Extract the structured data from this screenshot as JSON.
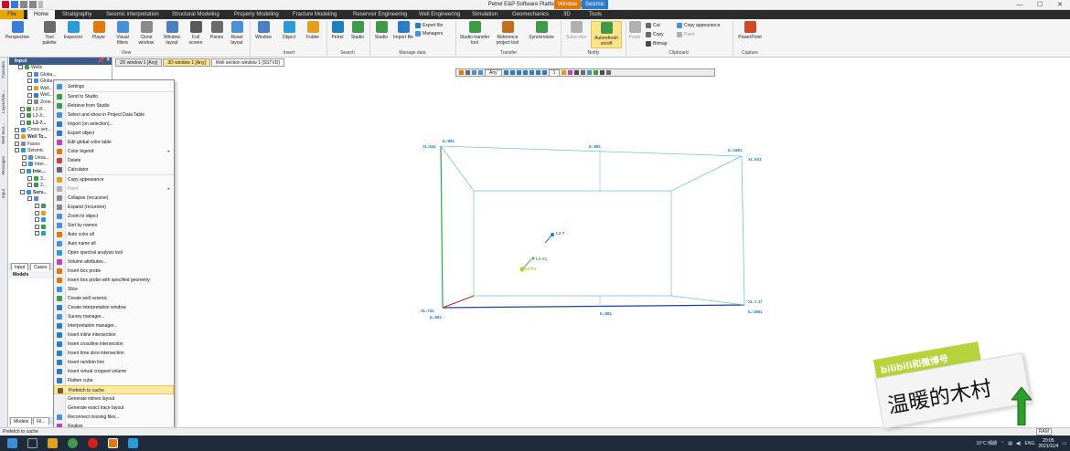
{
  "titlebar": {
    "title": "Petrel E&P Software Platform - [Video]",
    "context_window": "Window",
    "context_seismic": "Seismic",
    "minimize": "—",
    "maximize": "☐",
    "close": "✕"
  },
  "tabs": [
    "File",
    "Home",
    "Stratigraphy",
    "Seismic interpretation",
    "Structural Modeling",
    "Property Modeling",
    "Fracture Modeling",
    "Reservoir Engineering",
    "Well Engineering",
    "Simulation",
    "Geomechanics",
    "3D",
    "Tools"
  ],
  "ribbon": {
    "buttons": [
      {
        "label": "Perspective",
        "color": "#3a7bd5"
      },
      {
        "label": "Tool palette",
        "color": "#6a6a6a"
      },
      {
        "label": "Inspector",
        "color": "#2a9bd8"
      },
      {
        "label": "Player",
        "color": "#e07a10"
      },
      {
        "label": "Visual filters",
        "color": "#4a90d9"
      },
      {
        "label": "Clone window",
        "color": "#8a8a8a"
      },
      {
        "label": "Window layout",
        "color": "#4a7fc1"
      },
      {
        "label": "Full screen",
        "color": "#5a5a5a"
      },
      {
        "label": "Panes",
        "color": "#6b6b6b"
      },
      {
        "label": "Reset layout",
        "color": "#4a90d9"
      },
      {
        "label": "Window",
        "color": "#4a7fc1"
      },
      {
        "label": "Object",
        "color": "#2a9bd8"
      },
      {
        "label": "Folder",
        "color": "#e0a020"
      },
      {
        "label": "Petrel",
        "color": "#1e7fc0"
      },
      {
        "label": "Studio",
        "color": "#3f9a4a"
      },
      {
        "label": "Studio",
        "color": "#3f9a4a"
      },
      {
        "label": "Import file",
        "color": "#2a7bc8"
      },
      {
        "label": "Studio transfer tool",
        "color": "#3f9a4a"
      },
      {
        "label": "Reference project tool",
        "color": "#c07020"
      },
      {
        "label": "Synchronize",
        "color": "#3f9a4a"
      },
      {
        "label": "Subscribe",
        "color": "#b0b0b0"
      },
      {
        "label": "Autorefresh on/off",
        "color": "#3f9a4a"
      },
      {
        "label": "Paste",
        "color": "#b0b0b0"
      },
      {
        "label": "PowerPoint",
        "color": "#d04a2a"
      }
    ],
    "small": {
      "export_file": "Export file",
      "managers": "Managers",
      "cut": "Cut",
      "copy": "Copy",
      "bitmap": "Bitmap",
      "copy_appearance": "Copy appearance",
      "paint": "Paint"
    },
    "groups": [
      "View",
      "Insert",
      "Search",
      "Manage data",
      "Transfer",
      "Notify",
      "Clipboard",
      "Capture"
    ]
  },
  "side_tabs": [
    "Favorites",
    "Layers/Vie...",
    "Well Sect...",
    "Messages",
    "Input"
  ],
  "input_panel": {
    "title": "Input",
    "rows": [
      {
        "text": "Wells",
        "bold": false,
        "indent": 10,
        "color": "#3f9a4a"
      },
      {
        "text": "Globa...",
        "bold": false,
        "indent": 20,
        "color": "#4a90d9"
      },
      {
        "text": "Globa...",
        "bold": false,
        "indent": 20,
        "color": "#4a90d9"
      },
      {
        "text": "Well...",
        "bold": false,
        "indent": 20,
        "color": "#e0a020"
      },
      {
        "text": "Well...",
        "bold": false,
        "indent": 20,
        "color": "#2a7bc8"
      },
      {
        "text": "Zone...",
        "bold": false,
        "indent": 20,
        "color": "#8a8a8a"
      },
      {
        "text": "L2-P...",
        "bold": false,
        "indent": 12,
        "color": "#3f9a4a"
      },
      {
        "text": "L2-X...",
        "bold": false,
        "indent": 12,
        "color": "#3f9a4a"
      },
      {
        "text": "L2-7...",
        "bold": true,
        "indent": 12,
        "color": "#3f9a4a"
      },
      {
        "text": "Cross sec...",
        "bold": false,
        "indent": 6,
        "color": "#4a90d9"
      },
      {
        "text": "Well To...",
        "bold": true,
        "indent": 6,
        "color": "#e0a020"
      },
      {
        "text": "Faces",
        "bold": false,
        "indent": 6,
        "color": "#8a8a8a"
      },
      {
        "text": "Seismic",
        "bold": false,
        "indent": 6,
        "color": "#2a9bd8"
      },
      {
        "text": "Unsa...",
        "bold": false,
        "indent": 14,
        "color": "#4a90d9"
      },
      {
        "text": "Inter...",
        "bold": false,
        "indent": 14,
        "color": "#4a90d9"
      },
      {
        "text": "Inte...",
        "bold": true,
        "indent": 12,
        "color": "#2a9bd8"
      },
      {
        "text": "3...",
        "bold": false,
        "indent": 20,
        "color": "#3f9a4a"
      },
      {
        "text": "2...",
        "bold": false,
        "indent": 20,
        "color": "#3f9a4a"
      },
      {
        "text": "Surv...",
        "bold": true,
        "indent": 12,
        "color": "#2a9bd8"
      },
      {
        "text": "",
        "bold": false,
        "indent": 20,
        "color": "#4a90d9"
      },
      {
        "text": "",
        "bold": false,
        "indent": 28,
        "color": "#3f9a4a"
      },
      {
        "text": "",
        "bold": false,
        "indent": 28,
        "color": "#e0a020"
      },
      {
        "text": "",
        "bold": false,
        "indent": 28,
        "color": "#2a9bd8"
      },
      {
        "text": "",
        "bold": false,
        "indent": 28,
        "color": "#3f9a4a"
      },
      {
        "text": "",
        "bold": false,
        "indent": 28,
        "color": "#2a9bd8"
      }
    ],
    "tab_input": "Input",
    "tab_cases": "Cases",
    "models": "Models",
    "bottom_tab_models": "Models",
    "bottom_tab_files": "Fil..."
  },
  "window_tabs": [
    {
      "label": "2D window 1 [Any]",
      "state": "normal"
    },
    {
      "label": "3D window 1 [Any]",
      "state": "hot"
    },
    {
      "label": "Well section window 1 [SSTVD]",
      "state": "active"
    }
  ],
  "viewport_toolbar": {
    "dropdown": "Any",
    "number": "1"
  },
  "viewport_labels": {
    "tl": "XL:841",
    "tl2": "IL:881",
    "tm": "IL:881",
    "tr": "IL:1881",
    "tr2": "XL:641",
    "bl": "XL:741",
    "bl2": "IL:881",
    "bm": "IL:881",
    "br": "XL:7.1f",
    "br2": "IL:1881",
    "well1": "L2-7",
    "well2": "L2-X1",
    "well3": "L2-P1"
  },
  "context_menu": {
    "items": [
      {
        "label": "Settings",
        "icon": "gear-icon",
        "color": "#4a90d9",
        "disabled": false,
        "sub": false,
        "sep_before": false
      },
      {
        "label": "Send to Studio",
        "icon": "studio-icon",
        "color": "#3f9a4a",
        "disabled": false,
        "sub": false,
        "sep_before": true
      },
      {
        "label": "Retrieve from Studio",
        "icon": "studio-icon",
        "color": "#3f9a4a",
        "disabled": false,
        "sub": false,
        "sep_before": false
      },
      {
        "label": "Select and show in Project Data Table",
        "icon": "table-icon",
        "color": "#4a90d9",
        "disabled": false,
        "sub": false,
        "sep_before": false
      },
      {
        "label": "Import (on selection)...",
        "icon": "import-icon",
        "color": "#2a7bc8",
        "disabled": false,
        "sub": false,
        "sep_before": false
      },
      {
        "label": "Export object",
        "icon": "export-icon",
        "color": "#2a7bc8",
        "disabled": false,
        "sub": false,
        "sep_before": false
      },
      {
        "label": "Edit global color table",
        "icon": "color-table-icon",
        "color": "#c040c0",
        "disabled": false,
        "sub": false,
        "sep_before": false
      },
      {
        "label": "Color legend",
        "icon": "legend-icon",
        "color": "#e07a10",
        "disabled": false,
        "sub": true,
        "sep_before": false
      },
      {
        "label": "Delete",
        "icon": "delete-icon",
        "color": "#d04040",
        "disabled": false,
        "sub": false,
        "sep_before": false
      },
      {
        "label": "Calculator",
        "icon": "calculator-icon",
        "color": "#6a6a6a",
        "disabled": false,
        "sub": false,
        "sep_before": false
      },
      {
        "label": "Copy appearance",
        "icon": "copy-appearance-icon",
        "color": "#e0a020",
        "disabled": false,
        "sub": false,
        "sep_before": true
      },
      {
        "label": "Paint",
        "icon": "paint-icon",
        "color": "#b0b0b0",
        "disabled": true,
        "sub": true,
        "sep_before": false
      },
      {
        "label": "Collapse (recursive)",
        "icon": "collapse-icon",
        "color": "#8a8a8a",
        "disabled": false,
        "sub": false,
        "sep_before": false
      },
      {
        "label": "Expand (recursive)",
        "icon": "expand-icon",
        "color": "#8a8a8a",
        "disabled": false,
        "sub": false,
        "sep_before": false
      },
      {
        "label": "Zoom to object",
        "icon": "zoom-icon",
        "color": "#4a90d9",
        "disabled": false,
        "sub": false,
        "sep_before": false
      },
      {
        "label": "Sort by names",
        "icon": "sort-icon",
        "color": "#4a90d9",
        "disabled": false,
        "sub": false,
        "sep_before": false
      },
      {
        "label": "Auto color all",
        "icon": "auto-color-icon",
        "color": "#e07a10",
        "disabled": false,
        "sub": false,
        "sep_before": false
      },
      {
        "label": "Auto name all",
        "icon": "auto-name-icon",
        "color": "#4a90d9",
        "disabled": false,
        "sub": false,
        "sep_before": false
      },
      {
        "label": "Open spectral analysis tool",
        "icon": "spectral-icon",
        "color": "#2a9bd8",
        "disabled": false,
        "sub": false,
        "sep_before": false
      },
      {
        "label": "Volume attributes...",
        "icon": "volume-icon",
        "color": "#c040c0",
        "disabled": false,
        "sub": false,
        "sep_before": false
      },
      {
        "label": "Insert box probe",
        "icon": "box-probe-icon",
        "color": "#e07a10",
        "disabled": false,
        "sub": false,
        "sep_before": false
      },
      {
        "label": "Insert box probe with specified geometry",
        "icon": "box-probe-icon",
        "color": "#e07a10",
        "disabled": false,
        "sub": false,
        "sep_before": false
      },
      {
        "label": "Slice",
        "icon": "slice-icon",
        "color": "#4a90d9",
        "disabled": false,
        "sub": false,
        "sep_before": false
      },
      {
        "label": "Create well seismic",
        "icon": "well-seismic-icon",
        "color": "#3f9a4a",
        "disabled": false,
        "sub": false,
        "sep_before": false
      },
      {
        "label": "Create interpretation window",
        "icon": "interp-window-icon",
        "color": "#2a7bc8",
        "disabled": false,
        "sub": false,
        "sep_before": false
      },
      {
        "label": "Survey manager...",
        "icon": "survey-icon",
        "color": "#4a90d9",
        "disabled": false,
        "sub": false,
        "sep_before": false
      },
      {
        "label": "Interpretation manager...",
        "icon": "interp-manager-icon",
        "color": "#2a7bc8",
        "disabled": false,
        "sub": false,
        "sep_before": false
      },
      {
        "label": "Insert inline intersection",
        "icon": "inline-icon",
        "color": "#2a7bc8",
        "disabled": false,
        "sub": false,
        "sep_before": false
      },
      {
        "label": "Insert crossline intersection",
        "icon": "crossline-icon",
        "color": "#2a7bc8",
        "disabled": false,
        "sub": false,
        "sep_before": false
      },
      {
        "label": "Insert time slice intersection",
        "icon": "time-slice-icon",
        "color": "#2a7bc8",
        "disabled": false,
        "sub": false,
        "sep_before": false
      },
      {
        "label": "Insert random line",
        "icon": "random-line-icon",
        "color": "#2a7bc8",
        "disabled": false,
        "sub": false,
        "sep_before": false
      },
      {
        "label": "Insert virtual cropped volume",
        "icon": "crop-volume-icon",
        "color": "#2a7bc8",
        "disabled": false,
        "sub": false,
        "sep_before": false
      },
      {
        "label": "Flatten cube",
        "icon": "flatten-icon",
        "color": "#2a7bc8",
        "disabled": false,
        "sub": false,
        "sep_before": false
      },
      {
        "label": "Prefetch to cache",
        "icon": "prefetch-icon",
        "color": "#7a5a2a",
        "disabled": false,
        "sub": false,
        "sep_before": false,
        "highlight": true
      },
      {
        "label": "Generate inlines layout",
        "icon": "",
        "color": "",
        "disabled": false,
        "sub": false,
        "sep_before": false
      },
      {
        "label": "Generate exact trace layout",
        "icon": "",
        "color": "",
        "disabled": false,
        "sub": false,
        "sep_before": false
      },
      {
        "label": "Reconnect missing files...",
        "icon": "reconnect-icon",
        "color": "#4a90d9",
        "disabled": false,
        "sub": false,
        "sep_before": false
      },
      {
        "label": "Realize",
        "icon": "realize-icon",
        "color": "#c040c0",
        "disabled": false,
        "sub": false,
        "sep_before": false
      }
    ]
  },
  "statusbar": {
    "text": "Prefetch to cache",
    "ram": "RAM"
  },
  "taskbar": {
    "weather": "16°C 晴朗",
    "lang": "ENG",
    "time": "20:05",
    "date": "2021/11/4"
  },
  "watermark": {
    "bili": "bilibili和微博号",
    "name": "温暖的木村"
  }
}
